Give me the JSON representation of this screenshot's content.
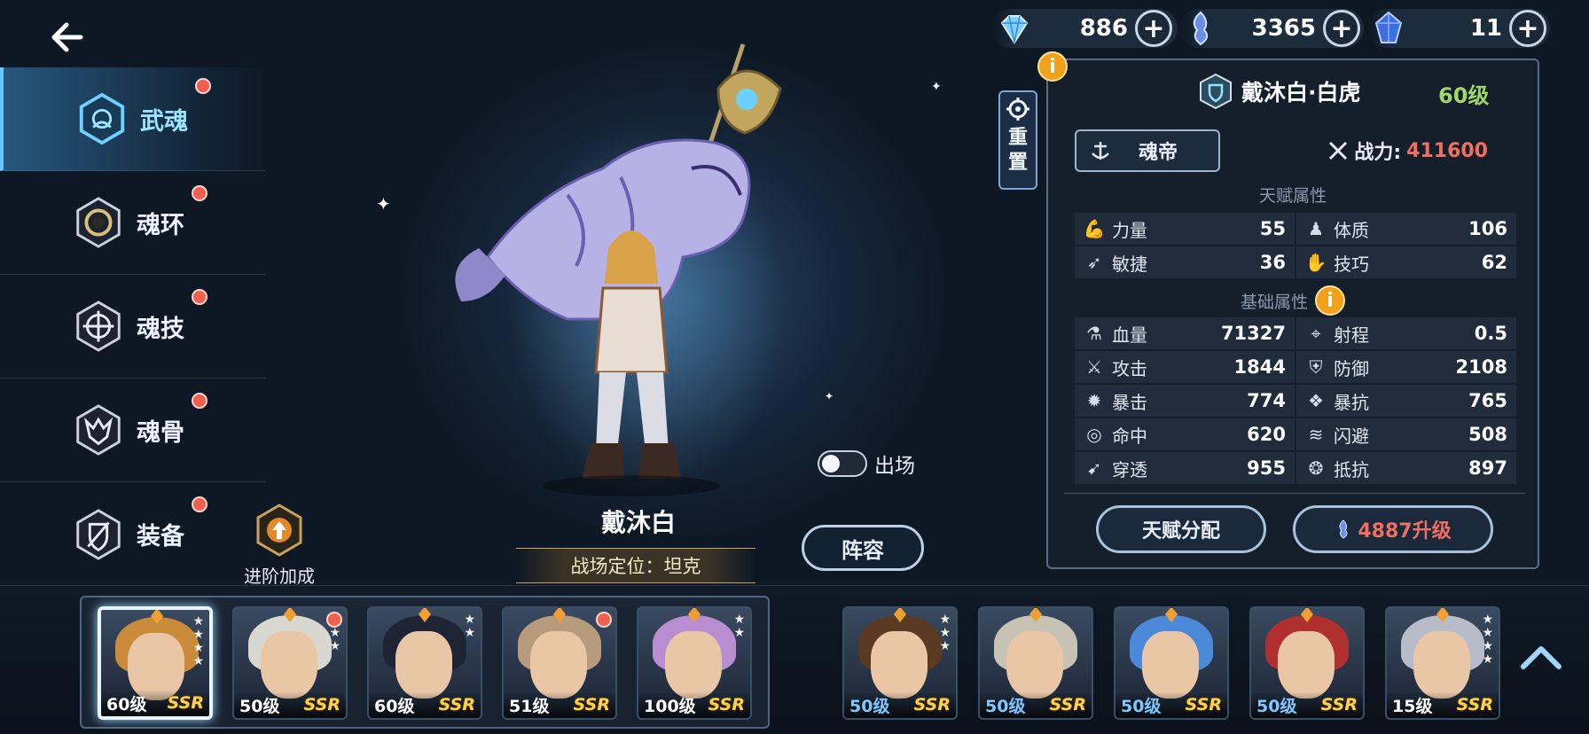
{
  "currencies": [
    {
      "icon": "diamond-icon",
      "value": "886"
    },
    {
      "icon": "soul-coin-icon",
      "value": "3365"
    },
    {
      "icon": "blue-crystal-icon",
      "value": "11"
    }
  ],
  "nav": {
    "items": [
      {
        "label": "武魂",
        "active": true
      },
      {
        "label": "魂环",
        "active": false
      },
      {
        "label": "魂技",
        "active": false
      },
      {
        "label": "魂骨",
        "active": false
      },
      {
        "label": "装备",
        "active": false
      }
    ],
    "advance_label": "进阶加成"
  },
  "character": {
    "name": "戴沐白",
    "role": "战场定位：坦克",
    "deploy_label": "出场",
    "deploy_on": false,
    "lineup_label": "阵容"
  },
  "reset_label": [
    "重",
    "置"
  ],
  "panel": {
    "hero_name": "戴沐白·白虎",
    "hero_level": "60级",
    "title": "魂帝",
    "power_label": "战力:",
    "power_value": "411600",
    "talent_header": "天赋属性",
    "talent_stats": [
      [
        {
          "icon": "strength-icon",
          "name": "力量",
          "value": "55"
        },
        {
          "icon": "constitution-icon",
          "name": "体质",
          "value": "106"
        }
      ],
      [
        {
          "icon": "agility-icon",
          "name": "敏捷",
          "value": "36"
        },
        {
          "icon": "skill-icon",
          "name": "技巧",
          "value": "62"
        }
      ]
    ],
    "base_header": "基础属性",
    "base_stats": [
      [
        {
          "icon": "hp-icon",
          "name": "血量",
          "value": "71327"
        },
        {
          "icon": "range-icon",
          "name": "射程",
          "value": "0.5"
        }
      ],
      [
        {
          "icon": "attack-icon",
          "name": "攻击",
          "value": "1844"
        },
        {
          "icon": "defense-icon",
          "name": "防御",
          "value": "2108"
        }
      ],
      [
        {
          "icon": "crit-icon",
          "name": "暴击",
          "value": "774"
        },
        {
          "icon": "crit-resist-icon",
          "name": "暴抗",
          "value": "765"
        }
      ],
      [
        {
          "icon": "accuracy-icon",
          "name": "命中",
          "value": "620"
        },
        {
          "icon": "dodge-icon",
          "name": "闪避",
          "value": "508"
        }
      ],
      [
        {
          "icon": "penetrate-icon",
          "name": "穿透",
          "value": "955"
        },
        {
          "icon": "resist-icon",
          "name": "抵抗",
          "value": "897"
        }
      ]
    ],
    "talent_btn": "天赋分配",
    "upgrade_btn": "4887升级"
  },
  "roster_owned": [
    {
      "level": "60级",
      "rarity": "SSR",
      "stars": 4,
      "selected": true,
      "dot": false,
      "hair": "#c98a3a"
    },
    {
      "level": "50级",
      "rarity": "SSR",
      "stars": 3,
      "selected": false,
      "dot": true,
      "hair": "#d8d8d0"
    },
    {
      "level": "60级",
      "rarity": "SSR",
      "stars": 2,
      "selected": false,
      "dot": false,
      "hair": "#1e2434"
    },
    {
      "level": "51级",
      "rarity": "SSR",
      "stars": 1,
      "selected": false,
      "dot": true,
      "hair": "#b89a7c"
    },
    {
      "level": "100级",
      "rarity": "SSR",
      "stars": 2,
      "selected": false,
      "dot": false,
      "hair": "#b98ed0"
    }
  ],
  "roster_other": [
    {
      "level": "50级",
      "rarity": "SSR",
      "stars": 3,
      "hair": "#5a3a22"
    },
    {
      "level": "50级",
      "rarity": "SSR",
      "stars": 0,
      "hair": "#c8c2b4"
    },
    {
      "level": "50级",
      "rarity": "SSR",
      "stars": 0,
      "hair": "#4a8ad8"
    },
    {
      "level": "50级",
      "rarity": "SSR",
      "stars": 0,
      "hair": "#b03030"
    },
    {
      "level": "15级",
      "rarity": "SSR",
      "stars": 4,
      "hair": "#b8bcc8"
    }
  ]
}
